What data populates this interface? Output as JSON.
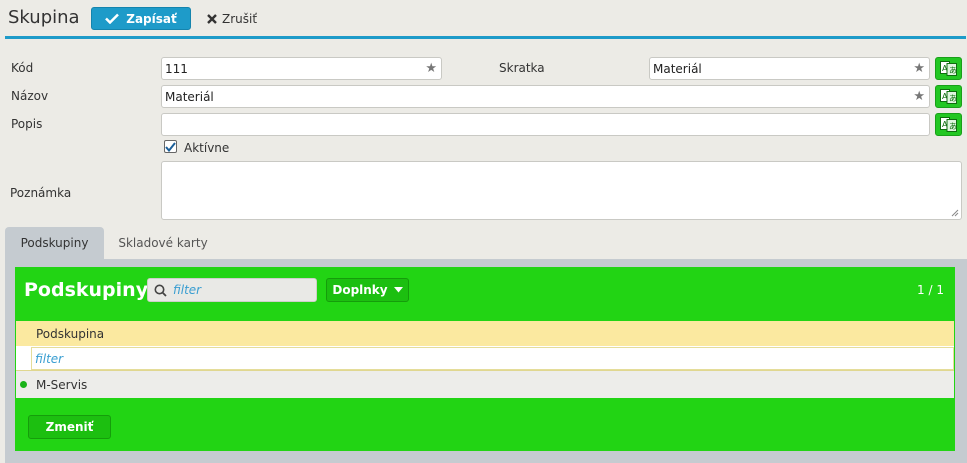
{
  "header": {
    "title": "Skupina",
    "save_label": "Zapísať",
    "cancel_label": "Zrušiť"
  },
  "form": {
    "kod": {
      "label": "Kód",
      "value": "111"
    },
    "skratka": {
      "label": "Skratka",
      "value": "Materiál"
    },
    "nazov": {
      "label": "Názov",
      "value": "Materiál"
    },
    "popis": {
      "label": "Popis",
      "value": ""
    },
    "aktivne": {
      "label": "Aktívne",
      "checked": true
    },
    "poznamka": {
      "label": "Poznámka",
      "value": ""
    }
  },
  "tabs": [
    {
      "label": "Podskupiny",
      "active": true
    },
    {
      "label": "Skladové karty",
      "active": false
    }
  ],
  "panel": {
    "title": "Podskupiny",
    "filter_placeholder": "filter",
    "dropdown_label": "Doplnky",
    "pager": "1 / 1",
    "column_header": "Podskupina",
    "column_filter_placeholder": "filter",
    "rows": [
      {
        "name": "M-Servis"
      }
    ],
    "edit_button": "Zmeniť"
  },
  "colors": {
    "accent": "#1e9bc9",
    "panel_green": "#22d414",
    "header_row": "#fbe9a0"
  }
}
